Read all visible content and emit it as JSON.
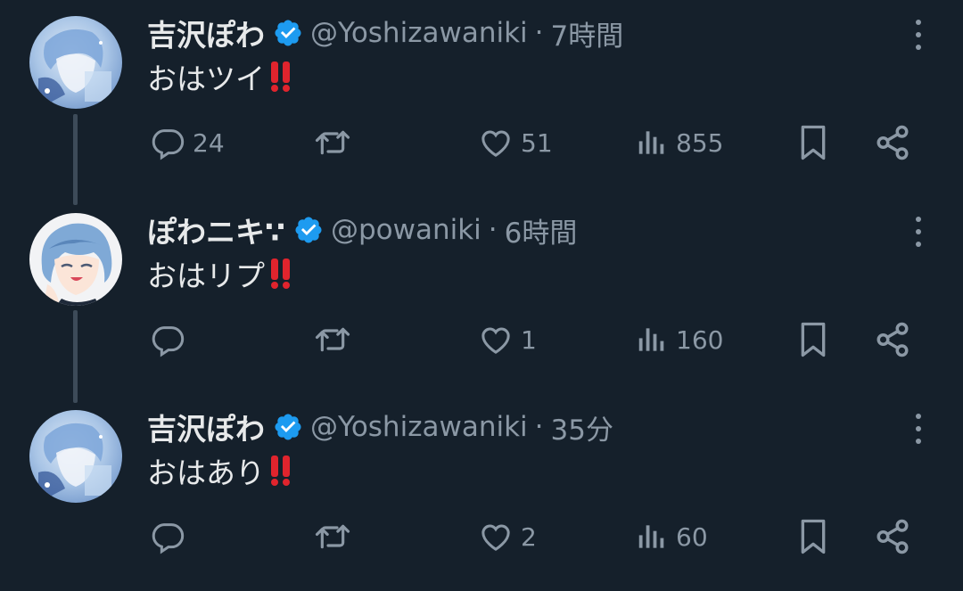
{
  "colors": {
    "background": "#15202b",
    "text_primary": "#e7e9ea",
    "text_secondary": "#8b98a5",
    "verified_badge": "#1d9bf0",
    "thread_line": "#3d4b59",
    "emoji_red": "#e0242d"
  },
  "icons": {
    "reply": "reply-icon",
    "retweet": "retweet-icon",
    "like": "heart-icon",
    "views": "analytics-icon",
    "bookmark": "bookmark-icon",
    "share": "share-icon",
    "more": "more-icon",
    "verified": "verified-badge-icon"
  },
  "tweets": [
    {
      "display_name": "吉沢ぽわ",
      "handle": "@Yoshizawaniki",
      "separator": "·",
      "time": "7時間",
      "text": "おはツイ",
      "emoji": "‼",
      "replies": "24",
      "retweets": "",
      "likes": "51",
      "views": "855"
    },
    {
      "display_name": "ぽわニキ∵",
      "handle": "@powaniki",
      "separator": "·",
      "time": "6時間",
      "text": "おはリプ",
      "emoji": "‼",
      "replies": "",
      "retweets": "",
      "likes": "1",
      "views": "160"
    },
    {
      "display_name": "吉沢ぽわ",
      "handle": "@Yoshizawaniki",
      "separator": "·",
      "time": "35分",
      "text": "おはあり",
      "emoji": "‼",
      "replies": "",
      "retweets": "",
      "likes": "2",
      "views": "60"
    }
  ]
}
